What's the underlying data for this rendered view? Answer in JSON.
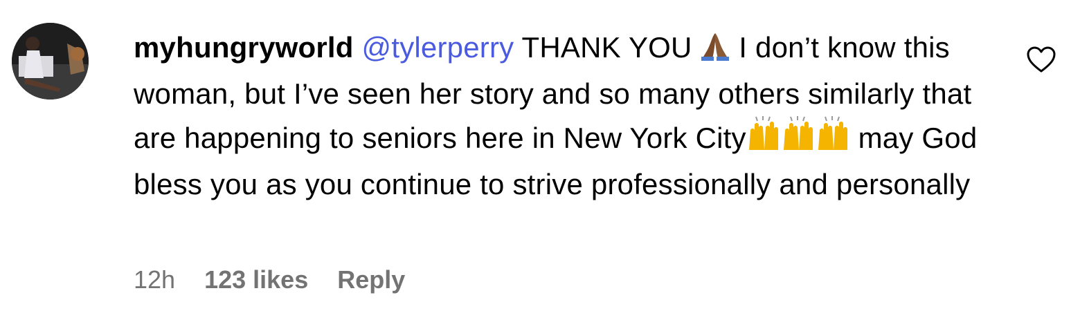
{
  "comment": {
    "username": "myhungryworld",
    "mention": "@tylerperry",
    "text_part_1": " THANK YOU ",
    "text_part_2": " I don’t know this woman, but I’ve seen her story and so many others similarly that are happening to seniors here in New York City",
    "text_part_3": " may God bless you as you continue to strive professionally and personally",
    "emoji_1": "folded-hands-dark-skin",
    "emoji_2": "raising-hands",
    "timestamp": "12h",
    "likes": "123 likes",
    "reply_label": "Reply"
  },
  "colors": {
    "mention": "#4a5be0",
    "meta": "#737373",
    "text": "#000000"
  }
}
